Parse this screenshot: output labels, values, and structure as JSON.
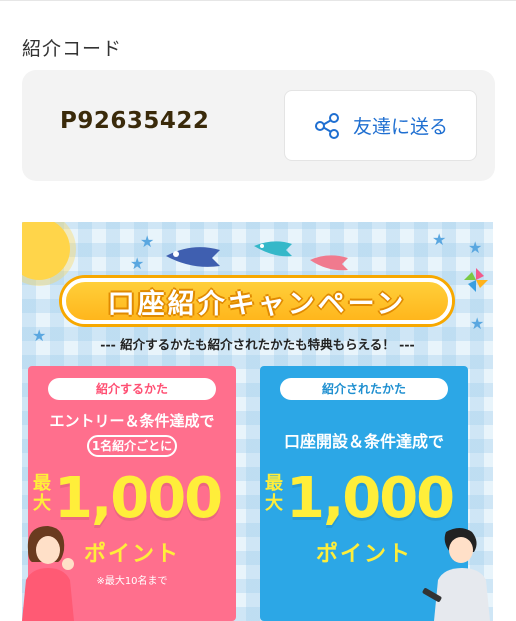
{
  "referral": {
    "section_label": "紹介コード",
    "code": "P92635422",
    "share_label": "友達に送る"
  },
  "banner": {
    "title": "口座紹介キャンペーン",
    "subtitle": "--- 紹介するかたも紹介されたかたも特典もらえる！ ---",
    "left": {
      "pill": "紹介するかた",
      "condition": "エントリー＆条件達成で",
      "per": "1名紹介ごとに",
      "max": "最大",
      "amount": "1,000",
      "points": "ポイント",
      "note": "※最大10名まで"
    },
    "right": {
      "pill": "紹介されたかた",
      "condition": "口座開設＆条件達成で",
      "max": "最大",
      "amount": "1,000",
      "points": "ポイント"
    }
  },
  "colors": {
    "accent_blue": "#1f6fd1",
    "left_panel": "#ff6f8d",
    "right_panel": "#2ca7e6",
    "highlight_yellow": "#ffee3a"
  }
}
